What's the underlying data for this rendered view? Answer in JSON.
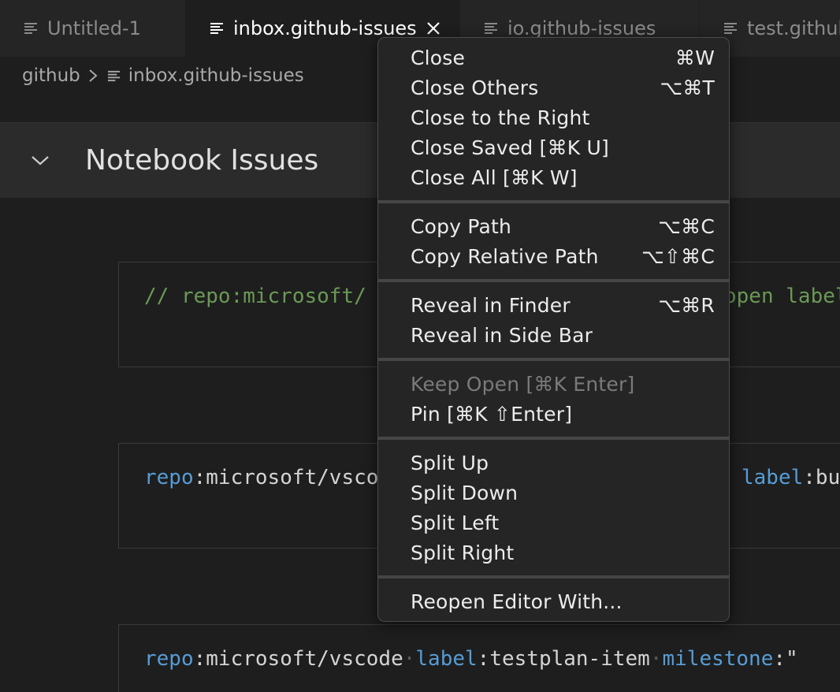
{
  "tabs": [
    {
      "label": "Untitled-1",
      "active": false
    },
    {
      "label": "inbox.github-issues",
      "active": true
    },
    {
      "label": "io.github-issues",
      "active": false
    },
    {
      "label": "test.github-issues",
      "active": false
    }
  ],
  "breadcrumb": {
    "folder": "github",
    "file": "inbox.github-issues"
  },
  "notebook": {
    "title": "Notebook Issues"
  },
  "cells": {
    "c1": {
      "comment": "// repo:microsoft/",
      "tail_key": "open label"
    },
    "c2": {
      "k1": "repo",
      "t1": ":microsoft/vsco",
      "k2": "label",
      "t2": ":bu"
    },
    "c3": {
      "k1": "repo",
      "t1": ":microsoft/vscode",
      "k2": "label",
      "t2": ":testplan-item",
      "k3": "milestone",
      "t3": ":\""
    }
  },
  "context_menu": {
    "items": [
      {
        "label": "Close",
        "shortcut": "⌘W"
      },
      {
        "label": "Close Others",
        "shortcut": "⌥⌘T"
      },
      {
        "label": "Close to the Right",
        "shortcut": ""
      },
      {
        "label": "Close Saved [⌘K U]",
        "shortcut": ""
      },
      {
        "label": "Close All [⌘K W]",
        "shortcut": ""
      },
      {
        "label": "Copy Path",
        "shortcut": "⌥⌘C"
      },
      {
        "label": "Copy Relative Path",
        "shortcut": "⌥⇧⌘C"
      },
      {
        "label": "Reveal in Finder",
        "shortcut": "⌥⌘R"
      },
      {
        "label": "Reveal in Side Bar",
        "shortcut": ""
      },
      {
        "label": "Keep Open [⌘K Enter]",
        "shortcut": "",
        "disabled": true
      },
      {
        "label": "Pin [⌘K ⇧Enter]",
        "shortcut": ""
      },
      {
        "label": "Split Up",
        "shortcut": ""
      },
      {
        "label": "Split Down",
        "shortcut": ""
      },
      {
        "label": "Split Left",
        "shortcut": ""
      },
      {
        "label": "Split Right",
        "shortcut": ""
      },
      {
        "label": "Reopen Editor With...",
        "shortcut": ""
      }
    ]
  },
  "icons": {
    "file": "lines-file-icon",
    "close": "close-icon",
    "chevron": "chevron-down-icon",
    "breadcrumb_sep": "chevron-right-icon"
  },
  "colors": {
    "comment": "#6a9955",
    "keyword": "#569cd6",
    "background": "#1e1e1e",
    "menu": "#252526"
  }
}
